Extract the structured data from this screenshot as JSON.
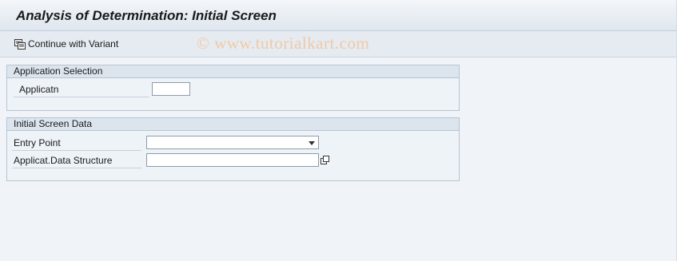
{
  "window": {
    "title": "Analysis of Determination: Initial Screen"
  },
  "toolbar": {
    "continue_label": "Continue with Variant",
    "continue_icon": "variant-icon"
  },
  "watermark": "© www.tutorialkart.com",
  "application_selection": {
    "title": "Application Selection",
    "applicatn_label": "Applicatn",
    "applicatn_value": ""
  },
  "initial_screen_data": {
    "title": "Initial Screen Data",
    "entry_point_label": "Entry Point",
    "entry_point_value": "",
    "data_structure_label": "Applicat.Data Structure",
    "data_structure_value": ""
  }
}
